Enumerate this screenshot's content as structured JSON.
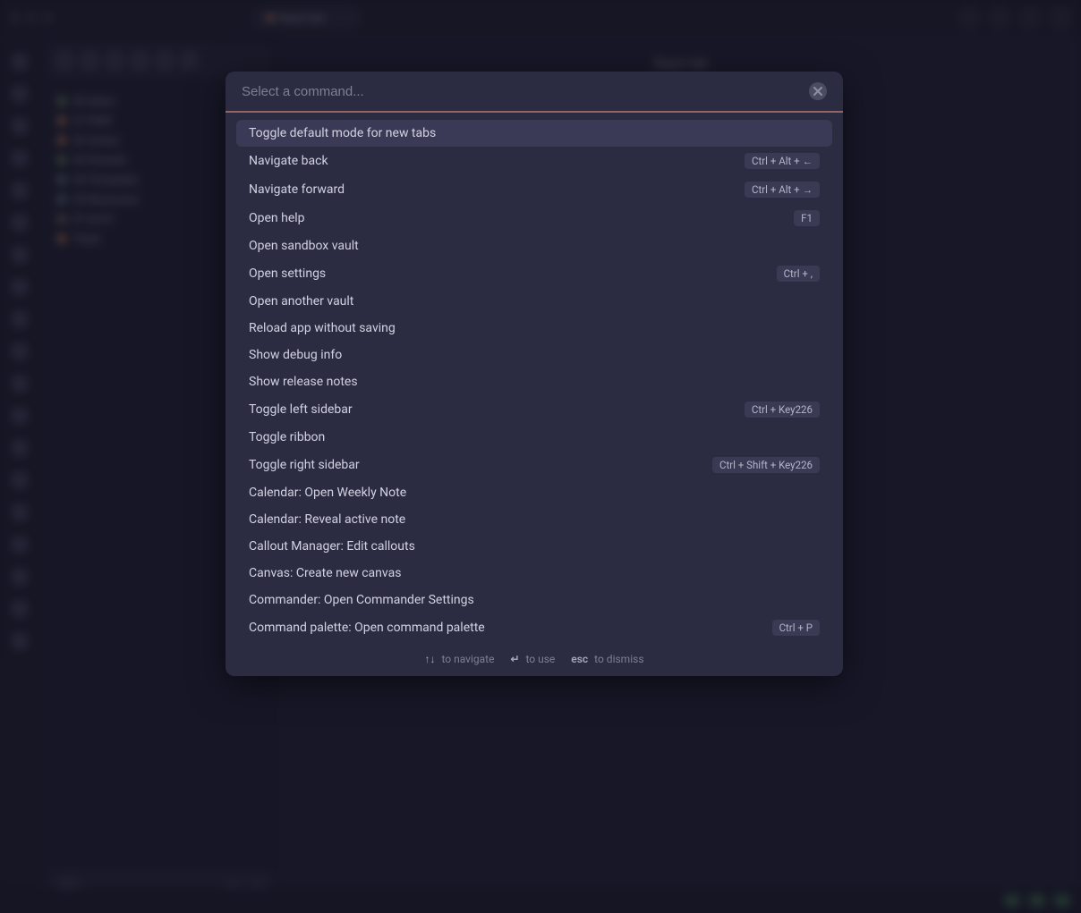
{
  "palette": {
    "placeholder": "Select a command...",
    "commands": [
      {
        "label": "Toggle default mode for new tabs",
        "hotkey": ""
      },
      {
        "label": "Navigate back",
        "hotkey": "Ctrl + Alt + ←"
      },
      {
        "label": "Navigate forward",
        "hotkey": "Ctrl + Alt + →"
      },
      {
        "label": "Open help",
        "hotkey": "F1"
      },
      {
        "label": "Open sandbox vault",
        "hotkey": ""
      },
      {
        "label": "Open settings",
        "hotkey": "Ctrl + ,"
      },
      {
        "label": "Open another vault",
        "hotkey": ""
      },
      {
        "label": "Reload app without saving",
        "hotkey": ""
      },
      {
        "label": "Show debug info",
        "hotkey": ""
      },
      {
        "label": "Show release notes",
        "hotkey": ""
      },
      {
        "label": "Toggle left sidebar",
        "hotkey": "Ctrl + Key226"
      },
      {
        "label": "Toggle ribbon",
        "hotkey": ""
      },
      {
        "label": "Toggle right sidebar",
        "hotkey": "Ctrl + Shift + Key226"
      },
      {
        "label": "Calendar: Open Weekly Note",
        "hotkey": ""
      },
      {
        "label": "Calendar: Reveal active note",
        "hotkey": ""
      },
      {
        "label": "Callout Manager: Edit callouts",
        "hotkey": ""
      },
      {
        "label": "Canvas: Create new canvas",
        "hotkey": ""
      },
      {
        "label": "Commander: Open Commander Settings",
        "hotkey": ""
      },
      {
        "label": "Command palette: Open command palette",
        "hotkey": "Ctrl + P"
      }
    ],
    "footer": {
      "nav_key": "↑↓",
      "nav_text": "to navigate",
      "use_key": "↵",
      "use_text": "to use",
      "esc_key": "esc",
      "esc_text": "to dismiss"
    }
  },
  "sidebar": {
    "items": [
      "00 Inbox",
      "01 PKM",
      "02 Action",
      "03 Periodic",
      "04 Templates",
      "05 Resources",
      "07 zk-01",
      "Trash"
    ]
  },
  "note_title": "React tab"
}
